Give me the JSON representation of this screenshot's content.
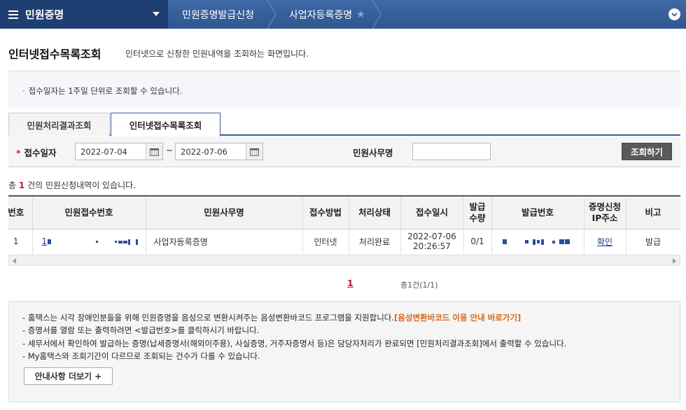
{
  "nav": {
    "title": "민원증명",
    "crumbs": [
      "민원증명발급신청",
      "사업자등록증명"
    ],
    "colors": {
      "bar": "#2f568f",
      "main": "#1f3f72"
    }
  },
  "page": {
    "title": "인터넷접수목록조회",
    "description": "인터넷으로 신청한 민원내역을 조회하는 화면입니다."
  },
  "notice": "접수일자는 1주일 단위로 조회할 수 있습니다.",
  "tabs": [
    {
      "label": "민원처리결과조회",
      "active": false
    },
    {
      "label": "인터넷접수목록조회",
      "active": true
    }
  ],
  "search": {
    "date_label": "접수일자",
    "date_from": "2022-07-04",
    "date_to": "2022-07-06",
    "tilde": "~",
    "office_label": "민원사무명",
    "office_value": "",
    "button": "조회하기"
  },
  "count": {
    "prefix": "총",
    "n": "1",
    "suffix": "건의 민원신청내역이 있습니다."
  },
  "table": {
    "headers": [
      "번호",
      "민원접수번호",
      "민원사무명",
      "접수방법",
      "처리상태",
      "접수일시",
      "발급\n수량",
      "발급번호",
      "증명신청\nIP주소",
      "비고"
    ],
    "rows": [
      {
        "no": "1",
        "receipt_prefix": "1",
        "office": "사업자등록증명",
        "method": "인터넷",
        "status": "처리완료",
        "date": "2022-07-06",
        "time": "20:26:57",
        "qty": "0/1",
        "ip": "확인",
        "note": "발급"
      }
    ]
  },
  "pager": {
    "current": "1",
    "info": "총1건(1/1)"
  },
  "info": {
    "lines": [
      {
        "text": "홈택스는 시각 장애인분들을 위해 민원증명을 음성으로 변환시켜주는 음성변환바코드 프로그램을 지원합니다.",
        "link": "[음성변환바코드 이용 안내 바로가기]"
      },
      {
        "text": "증명서를 열람 또는 출력하려면 <발급번호>를 클릭하시기 바랍니다."
      },
      {
        "text": "세무서에서 확인하여 발급하는 증명(납세증명서(해외이주용), 사실증명, 거주자증명서 등)은 담당자처리가 완료되면 [민원처리결과조회]에서 출력할 수 있습니다."
      },
      {
        "text": "My홈택스와 조회기간이 다르므로 조회되는 건수가 다를 수 있습니다."
      }
    ],
    "more_button": "안내사항 더보기 +"
  }
}
